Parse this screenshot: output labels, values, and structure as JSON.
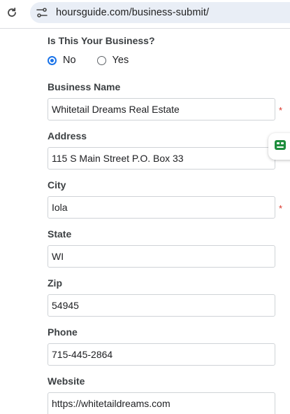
{
  "browser": {
    "url": "hoursguide.com/business-submit/"
  },
  "form": {
    "question": "Is This Your Business?",
    "options": [
      {
        "label": "No",
        "selected": true
      },
      {
        "label": "Yes",
        "selected": false
      }
    ],
    "required_marker": "*",
    "fields": {
      "business_name": {
        "label": "Business Name",
        "value": "Whitetail Dreams Real Estate"
      },
      "address": {
        "label": "Address",
        "value": "115 S Main Street P.O. Box 33"
      },
      "city": {
        "label": "City",
        "value": "Iola"
      },
      "state": {
        "label": "State",
        "value": "WI"
      },
      "zip": {
        "label": "Zip",
        "value": "54945"
      },
      "phone": {
        "label": "Phone",
        "value": "715-445-2864"
      },
      "website": {
        "label": "Website",
        "value": "https://whitetaildreams.com"
      }
    }
  },
  "colors": {
    "accent": "#1a73e8",
    "required": "#d93025",
    "extension": "#1e8e3e"
  }
}
